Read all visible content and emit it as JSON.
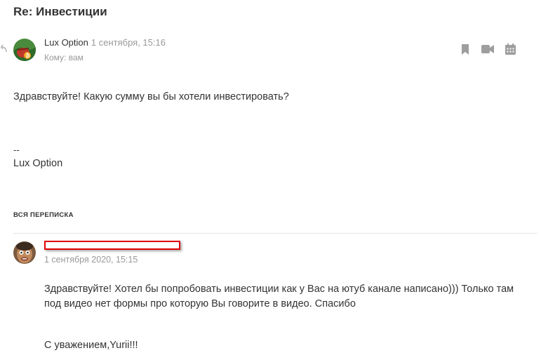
{
  "subject": "Re: Инвестиции",
  "message": {
    "sender": "Lux Option",
    "date": "1 сентября, 15:16",
    "to_line": "Кому: вам",
    "body": "Здравствуйте! Какую сумму вы бы хотели инвестировать?",
    "signature_separator": "--",
    "signature_name": "Lux Option"
  },
  "actions": {
    "icons": [
      "bookmark-icon",
      "video-icon",
      "calendar-icon"
    ]
  },
  "thread": {
    "label": "ВСЯ ПЕРЕПИСКА",
    "quoted": {
      "sender_redacted": true,
      "date": "1 сентября 2020, 15:15",
      "body_line1": "Здравствуйте! Хотел бы попробовать инвестиции как у Вас на ютуб канале написано))) Только там",
      "body_line2": "под видео нет формы про которую Вы говорите в видео. Спасибо",
      "regards": "С уважением,Yurii!!!"
    }
  },
  "colors": {
    "text": "#333333",
    "muted": "#999999",
    "icon": "#9e9e9e",
    "redaction_border": "#e00000",
    "divider": "#e5e5e5"
  }
}
